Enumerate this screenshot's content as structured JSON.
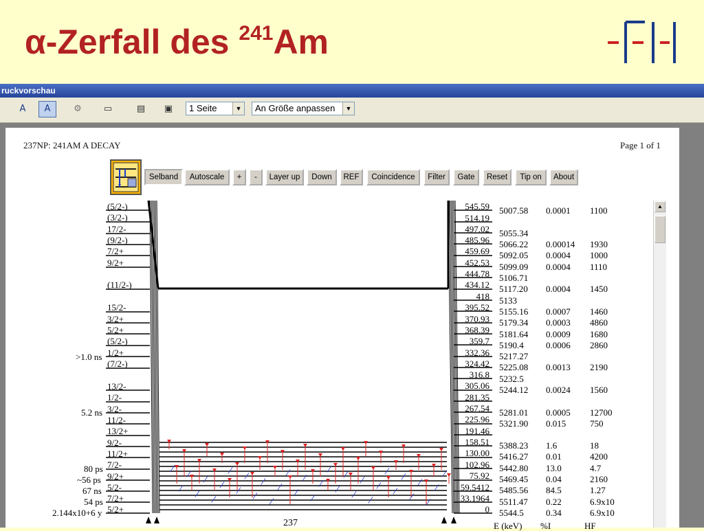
{
  "slide": {
    "title_prefix": "α-Zerfall des ",
    "title_mass": "241",
    "title_element": "Am"
  },
  "window": {
    "title": "ruckvorschau"
  },
  "toolbar": {
    "page_select": "1 Seite",
    "zoom_select": "An Größe anpassen"
  },
  "doc": {
    "header_left": "237NP: 241AM A DECAY",
    "header_right": "Page 1 of 1",
    "buttons": [
      "Selband",
      "Autoscale",
      "+",
      "-",
      "Layer up",
      "Down",
      "REF",
      "Coincidence",
      "Filter",
      "Gate",
      "Reset",
      "Tip on",
      "About"
    ],
    "daughter_label": "237",
    "col_headers": [
      "E (keV)",
      "%I",
      "HF"
    ],
    "spins": [
      "(5/2-)",
      "(3/2-)",
      "17/2-",
      "(9/2-)",
      "7/2+",
      "9/2+",
      "(11/2-)",
      "15/2-",
      "3/2+",
      "5/2+",
      "(5/2-)",
      "1/2+",
      "(7/2-)",
      "13/2-",
      "1/2-",
      "3/2-",
      "11/2-",
      "13/2+",
      "9/2-",
      "11/2+",
      "7/2-",
      "9/2+",
      "5/2-",
      "7/2+",
      "5/2+"
    ],
    "halflives": [
      ">1.0 ns",
      "5.2 ns",
      "80 ps",
      "~56 ps",
      "67 ns",
      "54 ps",
      "2.144x10+6 y"
    ],
    "levels": [
      "545.59",
      "514.19",
      "497.02",
      "485.96",
      "459.69",
      "452.53",
      "444.78",
      "434.12",
      "418",
      "395.52",
      "370.93",
      "368.39",
      "359.7",
      "332.36",
      "324.42",
      "316.8",
      "305.06",
      "281.35",
      "267.54",
      "225.96",
      "191.46",
      "158.51",
      "130.00",
      "102.96",
      "75.92",
      "59.5412",
      "33.1964",
      "0"
    ],
    "alpha_rows": [
      [
        "5007.58",
        "0.0001",
        "1100"
      ],
      [
        "5055.34",
        "",
        ""
      ],
      [
        "5066.22",
        "0.00014",
        "1930"
      ],
      [
        "5092.05",
        "0.0004",
        "1000"
      ],
      [
        "5099.09",
        "0.0004",
        "1110"
      ],
      [
        "5106.71",
        "",
        ""
      ],
      [
        "5117.20",
        "0.0004",
        "1450"
      ],
      [
        "5133",
        "",
        ""
      ],
      [
        "5155.16",
        "0.0007",
        "1460"
      ],
      [
        "5179.34",
        "0.0003",
        "4860"
      ],
      [
        "5181.64",
        "0.0009",
        "1680"
      ],
      [
        "5190.4",
        "0.0006",
        "2860"
      ],
      [
        "5217.27",
        "",
        ""
      ],
      [
        "5225.08",
        "0.0013",
        "2190"
      ],
      [
        "5232.5",
        "",
        ""
      ],
      [
        "5244.12",
        "0.0024",
        "1560"
      ],
      [
        "5281.01",
        "0.0005",
        "12700"
      ],
      [
        "5321.90",
        "0.015",
        "750"
      ],
      [
        "5388.23",
        "1.6",
        "18"
      ],
      [
        "5416.27",
        "0.01",
        "4200"
      ],
      [
        "5442.80",
        "13.0",
        "4.7"
      ],
      [
        "5469.45",
        "0.04",
        "2160"
      ],
      [
        "5485.56",
        "84.5",
        "1.27"
      ],
      [
        "5511.47",
        "0.22",
        "6.9x10"
      ],
      [
        "5544.5",
        "0.34",
        "6.9x10"
      ]
    ]
  },
  "colors": {
    "title": "#b22222",
    "slide_bg": "#ffffcc",
    "gamma_red": "#e02020",
    "gamma_blue": "#2030d0"
  }
}
